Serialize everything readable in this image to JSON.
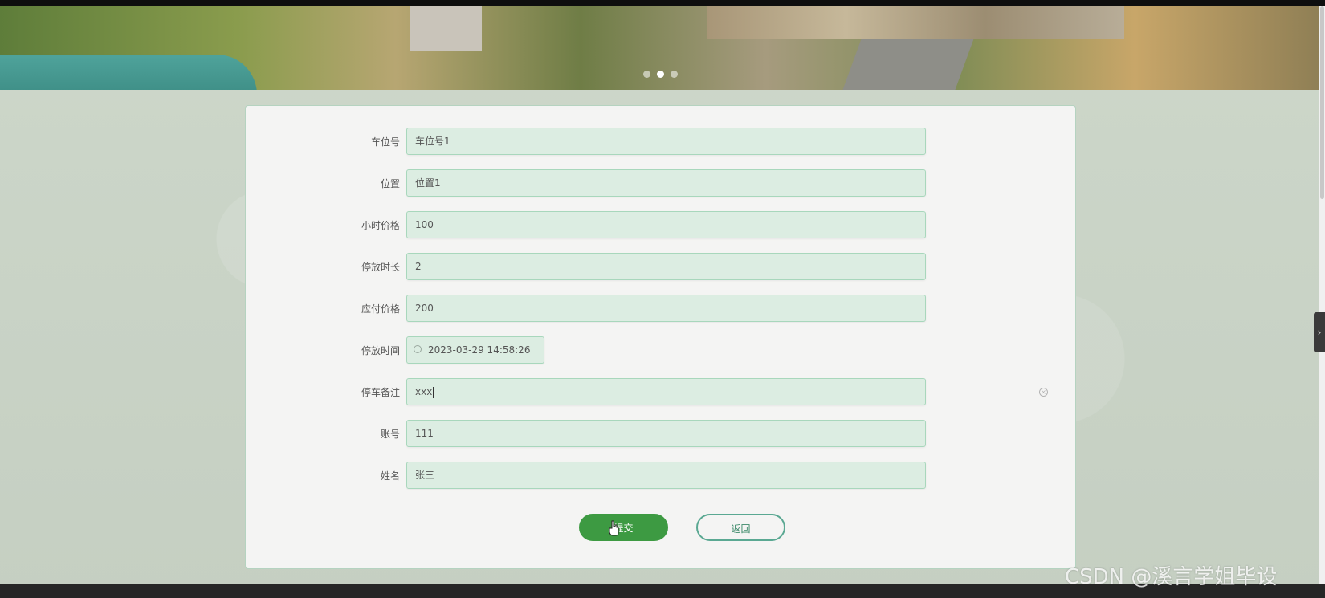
{
  "banner": {
    "slides": [
      "",
      "",
      ""
    ],
    "active_index": 1
  },
  "form": {
    "fields": [
      {
        "label": "车位号",
        "value": "车位号1"
      },
      {
        "label": "位置",
        "value": "位置1"
      },
      {
        "label": "小时价格",
        "value": "100"
      },
      {
        "label": "停放时长",
        "value": "2"
      },
      {
        "label": "应付价格",
        "value": "200"
      },
      {
        "label": "停放时间",
        "value": "2023-03-29 14:58:26"
      },
      {
        "label": "停车备注",
        "value": "xxx"
      },
      {
        "label": "账号",
        "value": "111"
      },
      {
        "label": "姓名",
        "value": "张三"
      }
    ],
    "submit_label": "提交",
    "back_label": "返回"
  },
  "side_toggle": {
    "glyph": "›"
  },
  "watermark": "CSDN @溪言学姐毕设",
  "colors": {
    "accent": "#3d9a42",
    "input_bg": "#dcede2",
    "input_border": "#a8d7bc",
    "page_bg": "#c9d3c6"
  }
}
